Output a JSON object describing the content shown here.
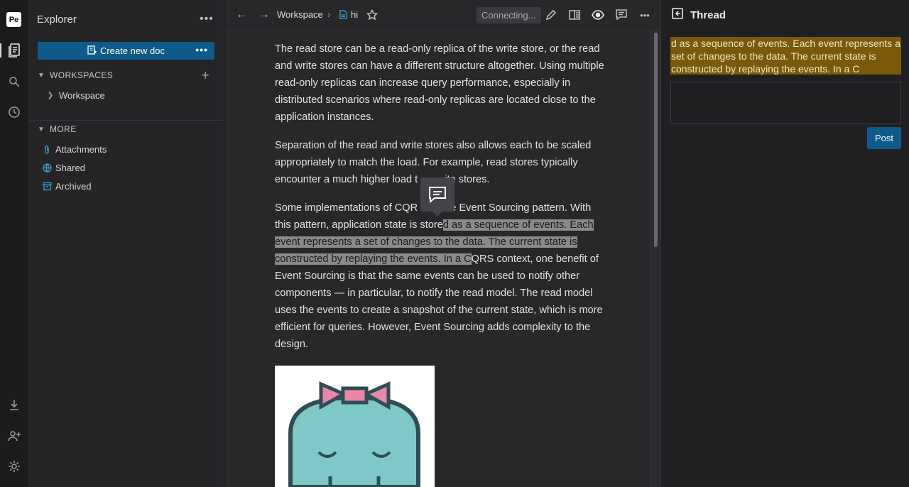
{
  "rail": {
    "logo": "Pe",
    "icons": [
      "documents-icon",
      "search-icon",
      "history-icon",
      "download-icon",
      "invite-icon",
      "settings-icon"
    ]
  },
  "explorer": {
    "title": "Explorer",
    "create_label": "Create new doc",
    "workspaces_header": "WORKSPACES",
    "workspace_item": "Workspace",
    "more_header": "MORE",
    "more_items": [
      {
        "label": "Attachments",
        "icon": "paperclip-icon",
        "color": "#3fa6d8"
      },
      {
        "label": "Shared",
        "icon": "globe-icon",
        "color": "#3fa6d8"
      },
      {
        "label": "Archived",
        "icon": "archive-icon",
        "color": "#3fa6d8"
      }
    ]
  },
  "toolbar": {
    "breadcrumb_workspace": "Workspace",
    "breadcrumb_doc": "hi",
    "status": "Connecting..."
  },
  "document": {
    "p1": "The read store can be a read-only replica of the write store, or the read and write stores can have a different structure altogether. Using multiple read-only replicas can increase query performance, especially in distributed scenarios where read-only replicas are located close to the application instances.",
    "p2a": "Separation of the read and write stores also allows each to be scaled appropriately to match the load. For example, read stores typically encounter a much higher load t",
    "p2b": "ite stores.",
    "p3_before": "Some implementations of CQR",
    "p3_mid": "he Event Sourcing pattern. With this pattern, application state is store",
    "p3_highlight": "d as a sequence of events. Each event represents a set of changes to the data. The current state is constructed by replaying the events. In a C",
    "p3_after": "QRS context, one benefit of Event Sourcing is that the same events can be used to notify other components — in particular, to notify the read model. The read model uses the events to create a snapshot of the current state, which is more efficient for queries. However, Event Sourcing adds complexity to the design."
  },
  "thread": {
    "title": "Thread",
    "quote": "d as a sequence of events. Each event represents a set of changes to the data. The current state is constructed by replaying the events. In a C",
    "post_label": "Post",
    "quote_bg": "#7a5a08"
  },
  "colors": {
    "accent": "#0e5a8a",
    "highlight": "#8a8a8a"
  }
}
